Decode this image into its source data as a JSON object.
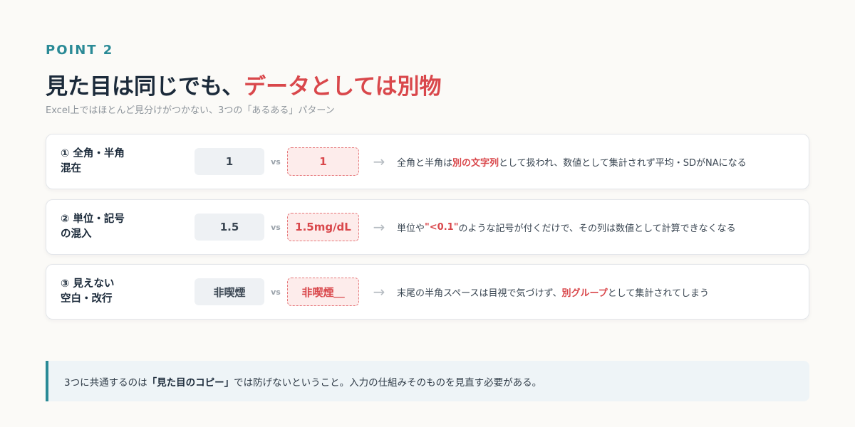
{
  "header": {
    "eyebrow": "POINT 2",
    "title_main": "見た目は同じでも、",
    "title_accent": "データとしては別物",
    "subtitle": "Excel上ではほとんど見分けがつかない、3つの「あるある」パターン"
  },
  "rows": [
    {
      "label_line1": "① 全角・半角",
      "label_line2": "混在",
      "value_a": "1",
      "vs": "vs",
      "value_b": "1",
      "arrow": "→",
      "desc_pre": "全角と半角は",
      "desc_hl": "別の文字列",
      "desc_post": "として扱われ、数値として集計されず平均・SDがNAになる"
    },
    {
      "label_line1": "② 単位・記号",
      "label_line2": "の混入",
      "value_a": "1.5",
      "vs": "vs",
      "value_b": "1.5mg/dL",
      "arrow": "→",
      "desc_pre": "単位や ",
      "desc_hl": "\"<0.1\"",
      "desc_post": " のような記号が付くだけで、その列は数値として計算できなくなる"
    },
    {
      "label_line1": "③ 見えない",
      "label_line2": "空白・改行",
      "value_a": "非喫煙",
      "vs": "vs",
      "value_b": "非喫煙＿",
      "arrow": "→",
      "desc_pre": "末尾の半角スペースは目視で気づけず、",
      "desc_hl": "別グループ",
      "desc_post": "として集計されてしまう"
    }
  ],
  "note": {
    "pre": "3つに共通するのは",
    "strong": "「見た目のコピー」",
    "post": "では防げないということ。入力の仕組みそのものを見直す必要がある。"
  },
  "colors": {
    "accent_teal": "#2a8a96",
    "accent_red": "#d9474b"
  }
}
